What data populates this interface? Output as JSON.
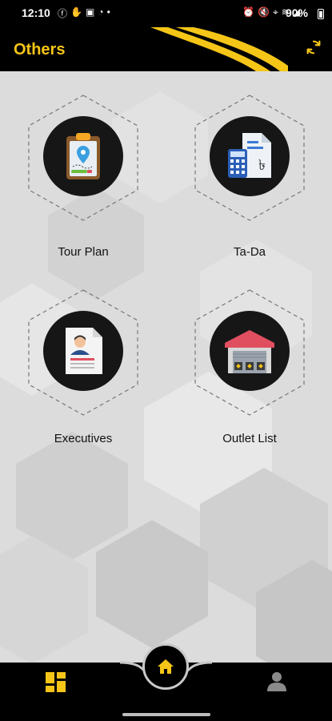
{
  "status_bar": {
    "time": "12:10",
    "battery": "90%"
  },
  "header": {
    "title": "Others",
    "refresh_icon": "refresh-icon"
  },
  "tiles": [
    {
      "label": "Tour Plan",
      "icon": "clipboard-map-pin-icon"
    },
    {
      "label": "Ta-Da",
      "icon": "calculator-document-icon"
    },
    {
      "label": "Executives",
      "icon": "profile-document-icon"
    },
    {
      "label": "Outlet List",
      "icon": "warehouse-icon"
    }
  ],
  "bottom_nav": {
    "items": [
      {
        "name": "dashboard",
        "icon": "dashboard-grid-icon"
      },
      {
        "name": "home",
        "icon": "home-icon"
      },
      {
        "name": "profile",
        "icon": "person-icon"
      }
    ]
  },
  "colors": {
    "accent": "#f5c518",
    "header_bg": "#000000",
    "content_bg": "#dcdcdc"
  }
}
